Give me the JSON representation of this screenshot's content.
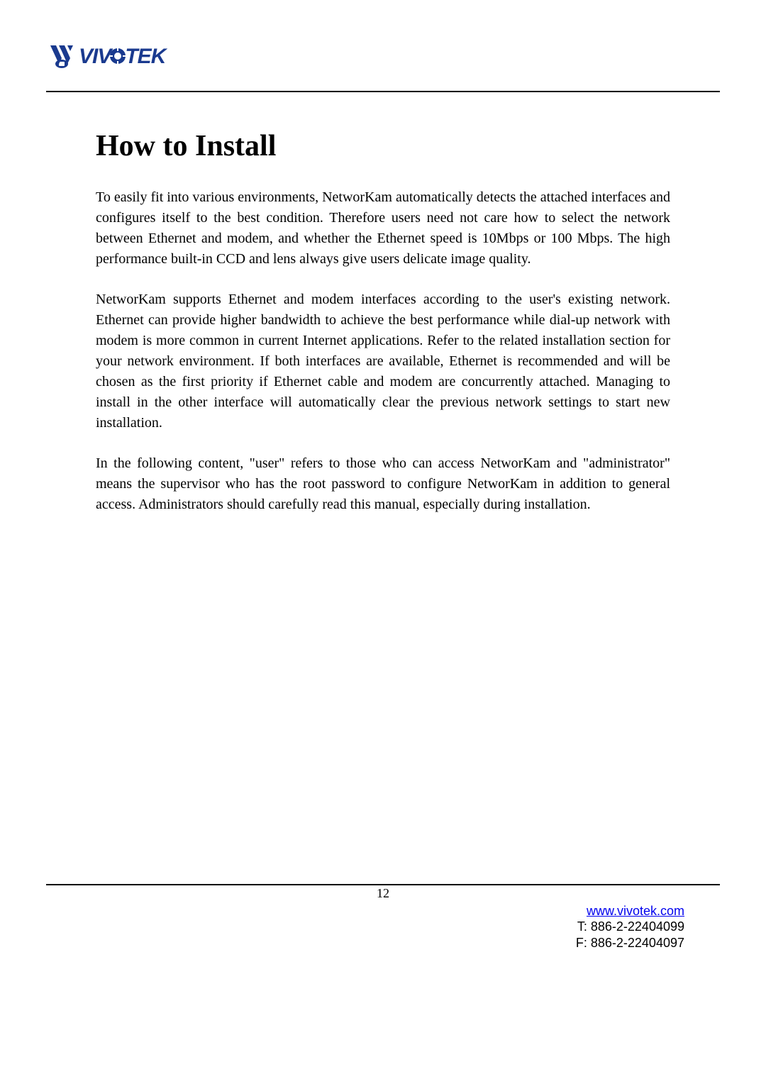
{
  "logo": {
    "brand_text": "VIVOTEK",
    "primary_color": "#1a3a8f"
  },
  "content": {
    "title": "How to Install",
    "paragraph1": "To easily fit into various environments, NetworKam automatically detects the attached interfaces and configures itself to the best condition. Therefore users need not care how to select the network between Ethernet and modem, and whether the Ethernet speed is 10Mbps or 100 Mbps. The high performance built-in CCD and lens always give users delicate image quality.",
    "paragraph2": "NetworKam supports Ethernet and modem interfaces according to the user's existing network. Ethernet can provide higher bandwidth to achieve the best performance while dial-up network with modem is more common in current Internet applications. Refer to the related installation section for your network environment. If both interfaces are available, Ethernet is recommended and will be chosen as the first priority if Ethernet cable and modem are concurrently attached. Managing to install in the other interface will automatically clear the previous network settings to start new installation.",
    "paragraph3": "In the following content, \"user\" refers to those who can access NetworKam and \"administrator\" means the supervisor who has the root password to configure NetworKam in addition to general access. Administrators should carefully read this manual, especially during installation."
  },
  "footer": {
    "page_number": "12",
    "website": "www.vivotek.com",
    "telephone": "T: 886-2-22404099",
    "fax": "F: 886-2-22404097"
  }
}
